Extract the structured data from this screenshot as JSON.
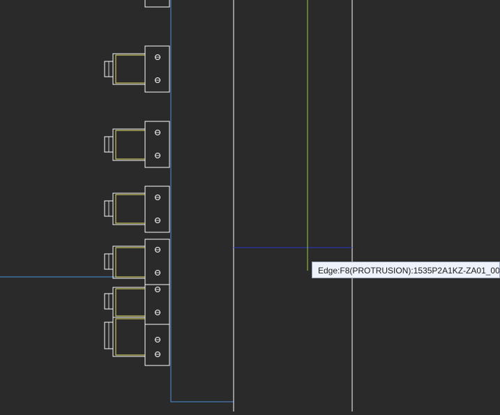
{
  "viewport": {
    "background": "#2a2a2a",
    "part_line_color": "#ffffff",
    "thread_line_color": "#e8e36a",
    "frame_line_color": "#4a90d9",
    "highlight_edge_color": "#1e2aa8",
    "highlight_vertical_color": "#9ccc3a"
  },
  "tooltip": {
    "text": "Edge:F8(PROTRUSION):1535P2A1KZ-ZA01_00"
  }
}
